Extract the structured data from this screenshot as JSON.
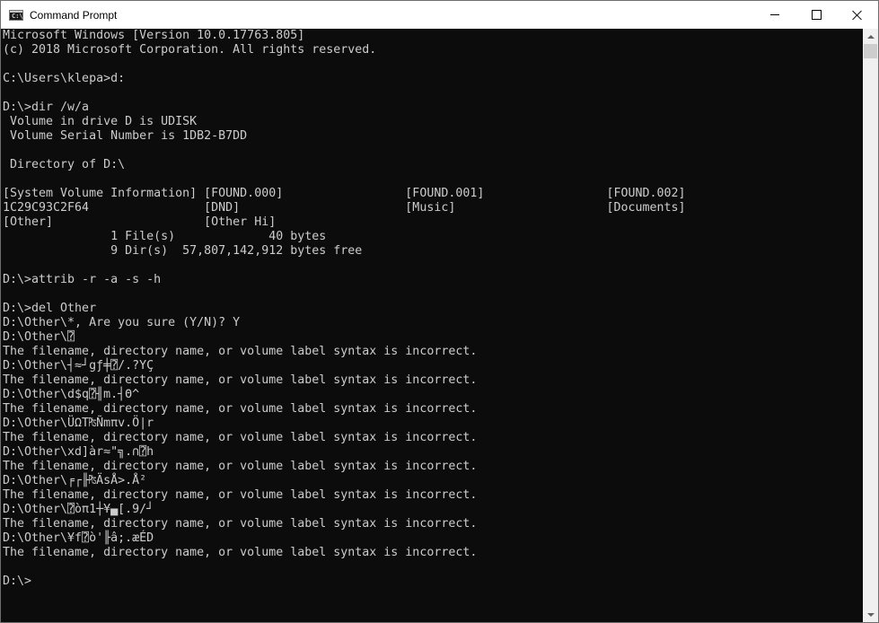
{
  "window": {
    "title": "Command Prompt",
    "icon_label": "C:\\",
    "icon": "console-app-icon",
    "controls": {
      "minimize_icon": "minimize-icon",
      "maximize_icon": "maximize-icon",
      "close_icon": "close-icon"
    }
  },
  "colors": {
    "console_background": "#0c0c0c",
    "console_text": "#cccccc",
    "titlebar_background": "#ffffff"
  },
  "console": {
    "lines": [
      "Microsoft Windows [Version 10.0.17763.805]",
      "(c) 2018 Microsoft Corporation. All rights reserved.",
      "",
      "C:\\Users\\klepa>d:",
      "",
      "D:\\>dir /w/a",
      " Volume in drive D is UDISK",
      " Volume Serial Number is 1DB2-B7DD",
      "",
      " Directory of D:\\",
      "",
      "[System Volume Information] [FOUND.000]                 [FOUND.001]                 [FOUND.002]",
      "1C29C93C2F64                [DND]                       [Music]                     [Documents]",
      "[Other]                     [Other Hi]",
      "               1 File(s)             40 bytes",
      "               9 Dir(s)  57,807,142,912 bytes free",
      "",
      "D:\\>attrib -r -a -s -h",
      "",
      "D:\\>del Other",
      "D:\\Other\\*, Are you sure (Y/N)? Y",
      "D:\\Other\\⍰",
      "The filename, directory name, or volume label syntax is incorrect.",
      "D:\\Other\\┤≈┘gƒ╪⍰/.?YÇ",
      "The filename, directory name, or volume label syntax is incorrect.",
      "D:\\Other\\d$q⍰╢m.┤Θ^",
      "The filename, directory name, or volume label syntax is incorrect.",
      "D:\\Other\\ÜΩT₧Ñmπv.Ö|r",
      "The filename, directory name, or volume label syntax is incorrect.",
      "D:\\Other\\xd]àr≈\"╗.∩⍰h",
      "The filename, directory name, or volume label syntax is incorrect.",
      "D:\\Other\\╒┌╟₧ÄsÅ>.Å²",
      "The filename, directory name, or volume label syntax is incorrect.",
      "D:\\Other\\⍰òπ1┼¥▄[.9/┘",
      "The filename, directory name, or volume label syntax is incorrect.",
      "D:\\Other\\¥f⍰ò'╟â;.æÉD",
      "The filename, directory name, or volume label syntax is incorrect.",
      "",
      "D:\\>"
    ]
  },
  "scrollbar": {
    "up_icon": "scroll-up-arrow-icon",
    "down_icon": "scroll-down-arrow-icon"
  }
}
